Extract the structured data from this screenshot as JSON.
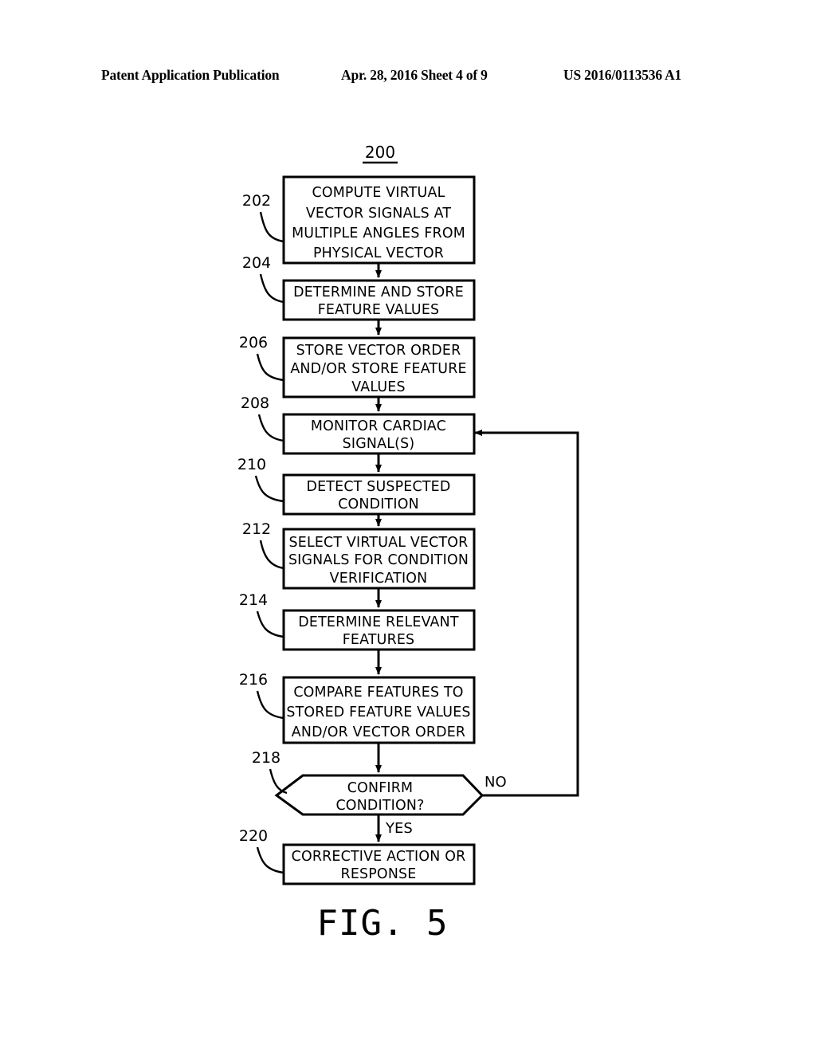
{
  "header": {
    "left": "Patent Application Publication",
    "center": "Apr. 28, 2016  Sheet 4 of 9",
    "right": "US 2016/0113536 A1"
  },
  "figure": {
    "caption": "FIG. 5",
    "diagram_number": "200"
  },
  "flowchart": {
    "type": "flowchart",
    "nodes": [
      {
        "ref": "202",
        "shape": "process",
        "lines": [
          "COMPUTE VIRTUAL",
          "VECTOR SIGNALS AT",
          "MULTIPLE ANGLES FROM",
          "PHYSICAL VECTOR"
        ]
      },
      {
        "ref": "204",
        "shape": "process",
        "lines": [
          "DETERMINE AND STORE",
          "FEATURE VALUES"
        ]
      },
      {
        "ref": "206",
        "shape": "process",
        "lines": [
          "STORE VECTOR ORDER",
          "AND/OR STORE FEATURE",
          "VALUES"
        ]
      },
      {
        "ref": "208",
        "shape": "process",
        "lines": [
          "MONITOR CARDIAC",
          "SIGNAL(S)"
        ]
      },
      {
        "ref": "210",
        "shape": "process",
        "lines": [
          "DETECT SUSPECTED",
          "CONDITION"
        ]
      },
      {
        "ref": "212",
        "shape": "process",
        "lines": [
          "SELECT VIRTUAL VECTOR",
          "SIGNALS FOR CONDITION",
          "VERIFICATION"
        ]
      },
      {
        "ref": "214",
        "shape": "process",
        "lines": [
          "DETERMINE RELEVANT",
          "FEATURES"
        ]
      },
      {
        "ref": "216",
        "shape": "process",
        "lines": [
          "COMPARE FEATURES TO",
          "STORED FEATURE VALUES",
          "AND/OR VECTOR ORDER"
        ]
      },
      {
        "ref": "218",
        "shape": "decision",
        "lines": [
          "CONFIRM",
          "CONDITION?"
        ]
      },
      {
        "ref": "220",
        "shape": "process",
        "lines": [
          "CORRECTIVE ACTION OR",
          "RESPONSE"
        ]
      }
    ],
    "edge_labels": {
      "decision_no": "NO",
      "decision_yes": "YES"
    }
  },
  "colors": {
    "stroke": "#000000",
    "background": "#ffffff"
  }
}
